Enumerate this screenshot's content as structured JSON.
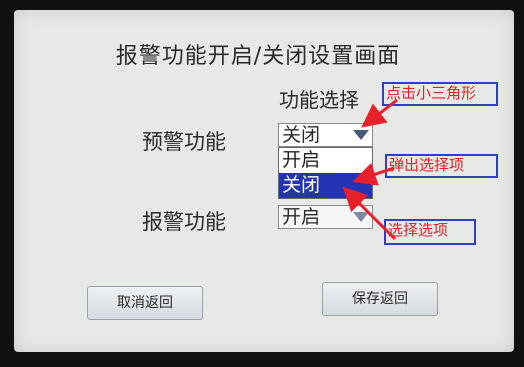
{
  "screen": {
    "title": "报警功能开启/关闭设置画面",
    "column_header": "功能选择"
  },
  "rows": [
    {
      "label": "预警功能",
      "selected_value": "关闭"
    },
    {
      "label": "报警功能",
      "selected_value": "开启"
    }
  ],
  "dropdown": {
    "options": [
      "开启",
      "关闭"
    ],
    "highlighted_index": 1,
    "highlight_color": "#2433b4"
  },
  "buttons": {
    "cancel": "取消返回",
    "save": "保存返回"
  },
  "annotations": {
    "tap_triangle": "点击小三角形",
    "popup_options": "弹出选择项",
    "choose_option": "选择选项",
    "text_color": "#e8202a",
    "border_color": "#3040c0"
  }
}
